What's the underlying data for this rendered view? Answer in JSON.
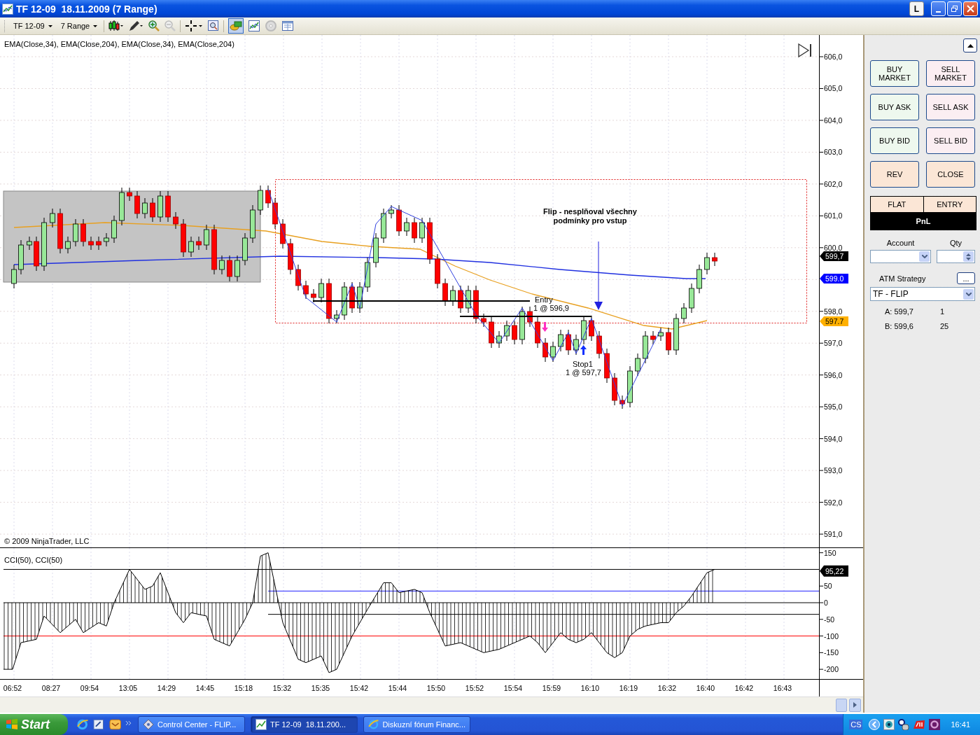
{
  "window": {
    "title": "TF 12-09  18.11.2009 (7 Range)",
    "buttons": [
      "L"
    ]
  },
  "toolbar": {
    "instrument": "TF 12-09",
    "period": "7 Range"
  },
  "price_panel": {
    "indicators_label": "EMA(Close,34), EMA(Close,204), EMA(Close,34), EMA(Close,204)",
    "copyright": "© 2009 NinjaTrader, LLC",
    "axis_labels": [
      "606,0",
      "605,0",
      "604,0",
      "603,0",
      "602,0",
      "601,0",
      "600,0",
      "598,0",
      "597,0",
      "596,0",
      "595,0",
      "594,0",
      "593,0",
      "592,0",
      "591,0"
    ],
    "price_tags": [
      {
        "text": "599,7",
        "color": "#000000"
      },
      {
        "text": "599.0",
        "color": "#0000ff"
      },
      {
        "text": "597.7",
        "color": "#ffb000"
      }
    ],
    "annotation": [
      "Flip - nesplňoval všechny",
      "podmínky pro vstup"
    ],
    "entry_label": [
      "Entry",
      "1 @ 596,9"
    ],
    "stop_label": [
      "Stop1",
      "1 @ 597,7"
    ]
  },
  "cci_panel": {
    "label": "CCI(50), CCI(50)",
    "axis_labels": [
      "150",
      "50",
      "0",
      "-50",
      "-100",
      "-150",
      "-200"
    ],
    "value_tag": "95,22"
  },
  "time_axis": [
    "06:52",
    "08:27",
    "09:54",
    "13:05",
    "14:29",
    "14:45",
    "15:18",
    "15:32",
    "15:35",
    "15:42",
    "15:44",
    "15:50",
    "15:52",
    "15:54",
    "15:59",
    "16:10",
    "16:19",
    "16:32",
    "16:40",
    "16:42",
    "16:43"
  ],
  "side_panel": {
    "order_buttons": [
      {
        "label": "BUY MARKET",
        "kind": "buy"
      },
      {
        "label": "SELL MARKET",
        "kind": "sell"
      },
      {
        "label": "BUY ASK",
        "kind": "buy"
      },
      {
        "label": "SELL ASK",
        "kind": "sell"
      },
      {
        "label": "BUY BID",
        "kind": "buy"
      },
      {
        "label": "SELL BID",
        "kind": "sell"
      },
      {
        "label": "REV",
        "kind": "other"
      },
      {
        "label": "CLOSE",
        "kind": "other"
      }
    ],
    "position": {
      "status": "FLAT",
      "entry": "ENTRY",
      "pnl": "PnL"
    },
    "account_label": "Account",
    "qty_label": "Qty",
    "atm_label": "ATM Strategy",
    "atm_button": "...",
    "atm_value": "TF - FLIP",
    "quotes": [
      {
        "label": "A: 599,7",
        "size": "1"
      },
      {
        "label": "B: 599,6",
        "size": "25"
      }
    ]
  },
  "taskbar": {
    "start": "Start",
    "tasks": [
      {
        "label": "Control Center - FLIP...",
        "selected": false
      },
      {
        "label": "TF 12-09  18.11.200...",
        "selected": true
      },
      {
        "label": "Diskuzní fórum Financ...",
        "selected": false
      }
    ],
    "language": "CS",
    "clock": "16:41"
  }
}
